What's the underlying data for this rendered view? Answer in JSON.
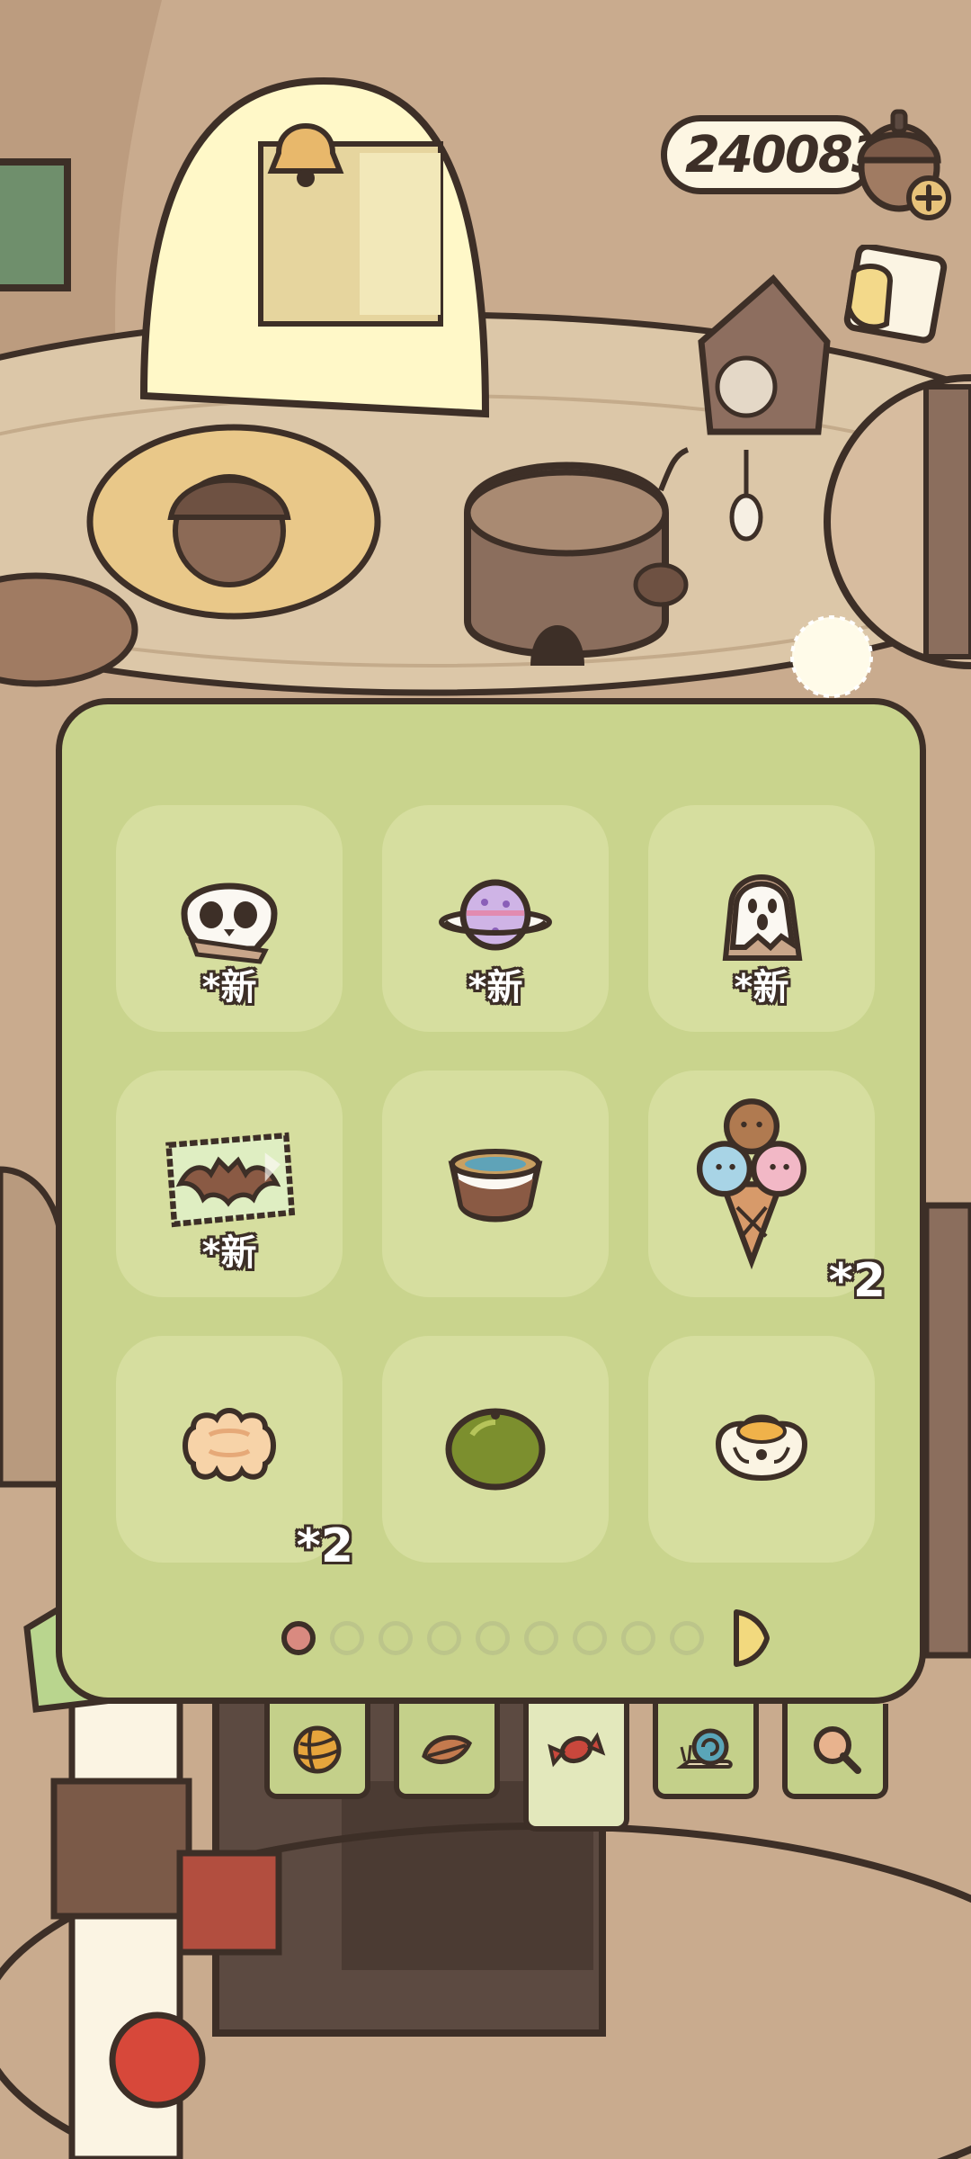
{
  "currency": {
    "amount": "240083"
  },
  "inventory": {
    "slots": [
      {
        "item": "skull-cookie",
        "tag": "*新",
        "count": ""
      },
      {
        "item": "planet-candy",
        "tag": "*新",
        "count": ""
      },
      {
        "item": "ghost-toast",
        "tag": "*新",
        "count": ""
      },
      {
        "item": "bat-chocolate",
        "tag": "*新",
        "count": ""
      },
      {
        "item": "pudding-cup",
        "tag": "",
        "count": ""
      },
      {
        "item": "animal-ice-cream-cone",
        "tag": "",
        "count": "*2"
      },
      {
        "item": "mooncake",
        "tag": "",
        "count": "*2"
      },
      {
        "item": "green-tangerine",
        "tag": "",
        "count": ""
      },
      {
        "item": "shumai",
        "tag": "",
        "count": ""
      }
    ]
  },
  "pager": {
    "pages": 9,
    "current_page": 1
  },
  "tabs": [
    {
      "icon": "yarn-ball-icon",
      "active": false
    },
    {
      "icon": "leaf-icon",
      "active": false
    },
    {
      "icon": "candy-icon",
      "active": true
    },
    {
      "icon": "snail-icon",
      "active": false
    },
    {
      "icon": "magnifier-icon",
      "active": false
    }
  ],
  "colors": {
    "panel": "#c9d48d",
    "slot": "#d6de9f",
    "outline": "#3d2f27",
    "room": "#c9ab8e"
  }
}
